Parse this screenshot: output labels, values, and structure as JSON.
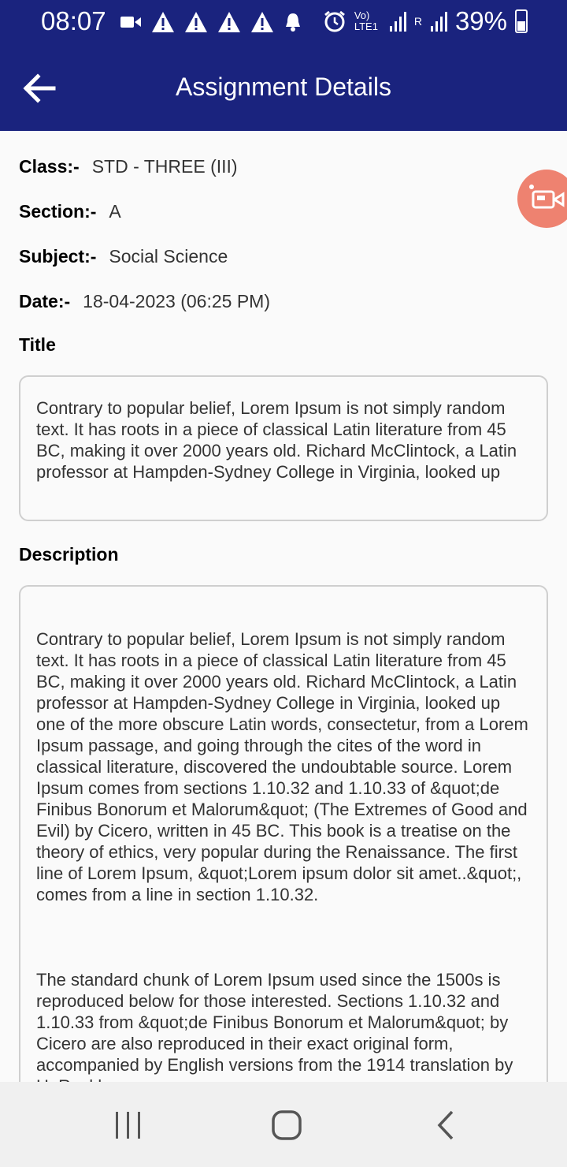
{
  "status_bar": {
    "time": "08:07",
    "network_label": "Vo) LTE1",
    "roaming_label": "R",
    "battery": "39%"
  },
  "app_bar": {
    "title": "Assignment Details",
    "color": "#1a237e"
  },
  "details": {
    "class_label": "Class:-",
    "class_value": "STD - THREE (III)",
    "section_label": "Section:-",
    "section_value": "A",
    "subject_label": "Subject:-",
    "subject_value": "Social Science",
    "date_label": "Date:-",
    "date_value": "18-04-2023 (06:25 PM)"
  },
  "title_section": {
    "heading": "Title",
    "text": "Contrary to popular belief, Lorem Ipsum is not simply random text. It has roots in a piece of classical Latin literature from 45 BC, making it over 2000 years old. Richard McClintock, a Latin professor at Hampden-Sydney College in Virginia, looked up"
  },
  "description_section": {
    "heading": "Description",
    "paragraph1": "Contrary to popular belief, Lorem Ipsum is not simply random text. It has roots in a piece of classical Latin literature from 45 BC, making it over 2000 years old. Richard McClintock, a Latin professor at Hampden-Sydney College in Virginia, looked up one of the more obscure Latin words, consectetur, from a Lorem Ipsum passage, and going through the cites of the word in classical literature, discovered the undoubtable source. Lorem Ipsum comes from sections 1.10.32 and 1.10.33 of &quot;de Finibus Bonorum et Malorum&quot; (The Extremes of Good and Evil) by Cicero, written in 45 BC. This book is a treatise on the theory of ethics, very popular during the Renaissance. The first line of Lorem Ipsum, &quot;Lorem ipsum dolor sit amet..&quot;, comes from a line in section 1.10.32.",
    "paragraph2": "The standard chunk of Lorem Ipsum used since the 1500s is reproduced below for those interested. Sections 1.10.32 and 1.10.33 from &quot;de Finibus Bonorum et Malorum&quot; by Cicero are also reproduced in their exact original form, accompanied by English versions from the 1914 translation by H. Rackham"
  },
  "icons": {
    "back": "arrow-left-icon",
    "fab": "video-camera-icon",
    "nav_recents": "recents-icon",
    "nav_home": "home-icon",
    "nav_back": "chevron-left-icon"
  },
  "colors": {
    "fab": "#ee8270",
    "navbar": "#f0f0f0"
  }
}
